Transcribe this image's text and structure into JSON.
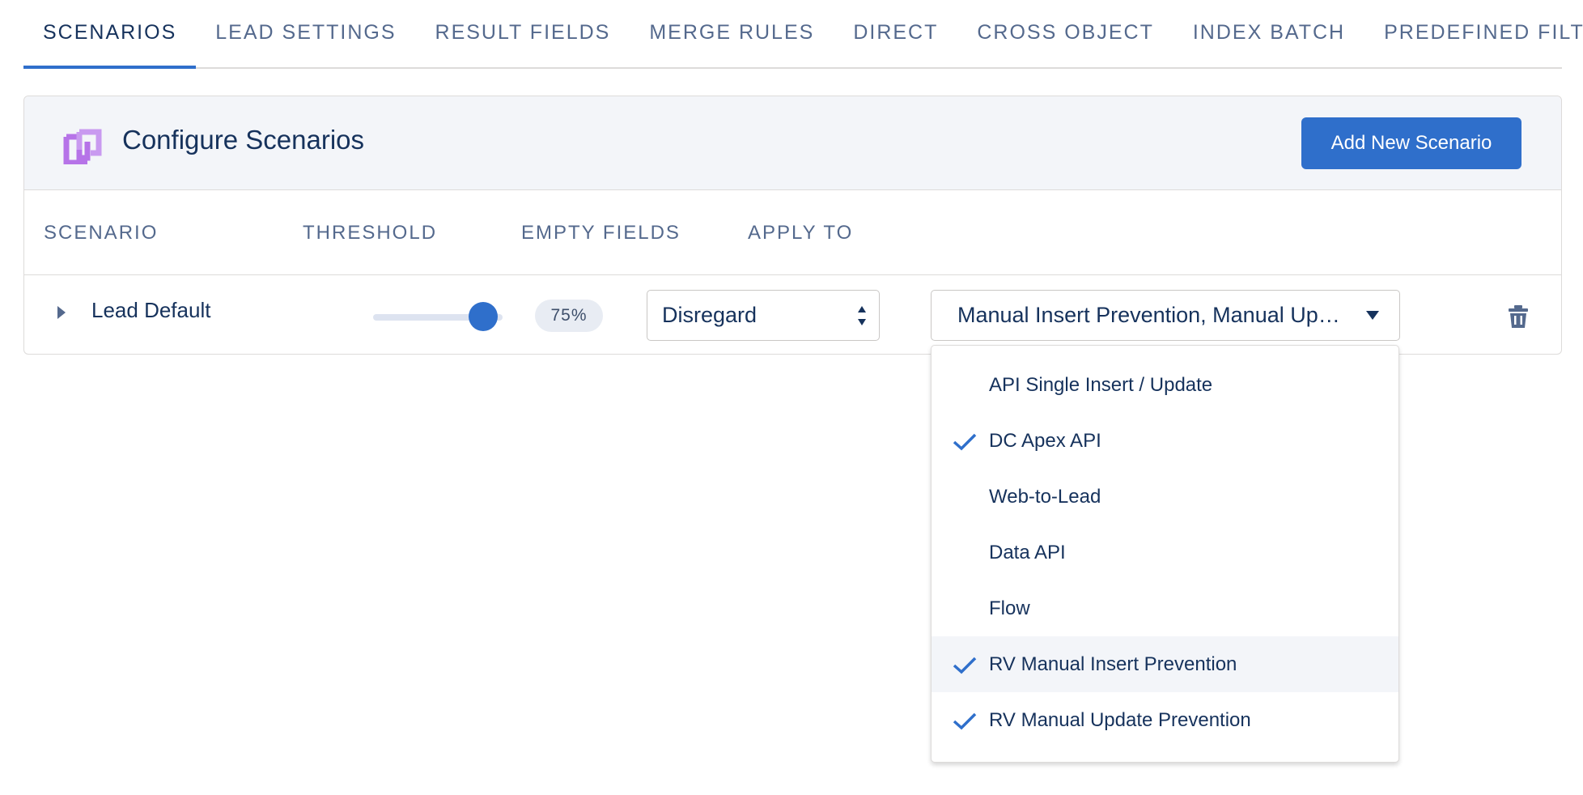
{
  "tabs": [
    {
      "label": "SCENARIOS",
      "active": true
    },
    {
      "label": "LEAD SETTINGS",
      "active": false
    },
    {
      "label": "RESULT FIELDS",
      "active": false
    },
    {
      "label": "MERGE RULES",
      "active": false
    },
    {
      "label": "DIRECT",
      "active": false
    },
    {
      "label": "CROSS OBJECT",
      "active": false
    },
    {
      "label": "INDEX BATCH",
      "active": false
    },
    {
      "label": "PREDEFINED FILTERS",
      "active": false
    }
  ],
  "header": {
    "title": "Configure Scenarios",
    "add_button": "Add New Scenario",
    "logo_icon": "duplicate-check-logo-icon"
  },
  "columns": {
    "scenario": "SCENARIO",
    "threshold": "THRESHOLD",
    "empty_fields": "EMPTY FIELDS",
    "apply_to": "APPLY TO"
  },
  "row": {
    "name": "Lead Default",
    "threshold_value": 75,
    "threshold_label": "75%",
    "empty_fields_value": "Disregard",
    "apply_to_value": "Manual Insert Prevention, Manual Update Prevention"
  },
  "dropdown": {
    "options": [
      {
        "label": "API Single Insert / Update",
        "checked": false
      },
      {
        "label": "DC Apex API",
        "checked": true
      },
      {
        "label": "Web-to-Lead",
        "checked": false
      },
      {
        "label": "Data API",
        "checked": false
      },
      {
        "label": "Flow",
        "checked": false
      },
      {
        "label": "RV Manual Insert Prevention",
        "checked": true
      },
      {
        "label": "RV Manual Update Prevention",
        "checked": true
      }
    ],
    "hovered_index": 5
  },
  "colors": {
    "brand": "#2f6fcb",
    "text": "#16325c",
    "muted": "#54698d",
    "logo": "#b673e8"
  }
}
